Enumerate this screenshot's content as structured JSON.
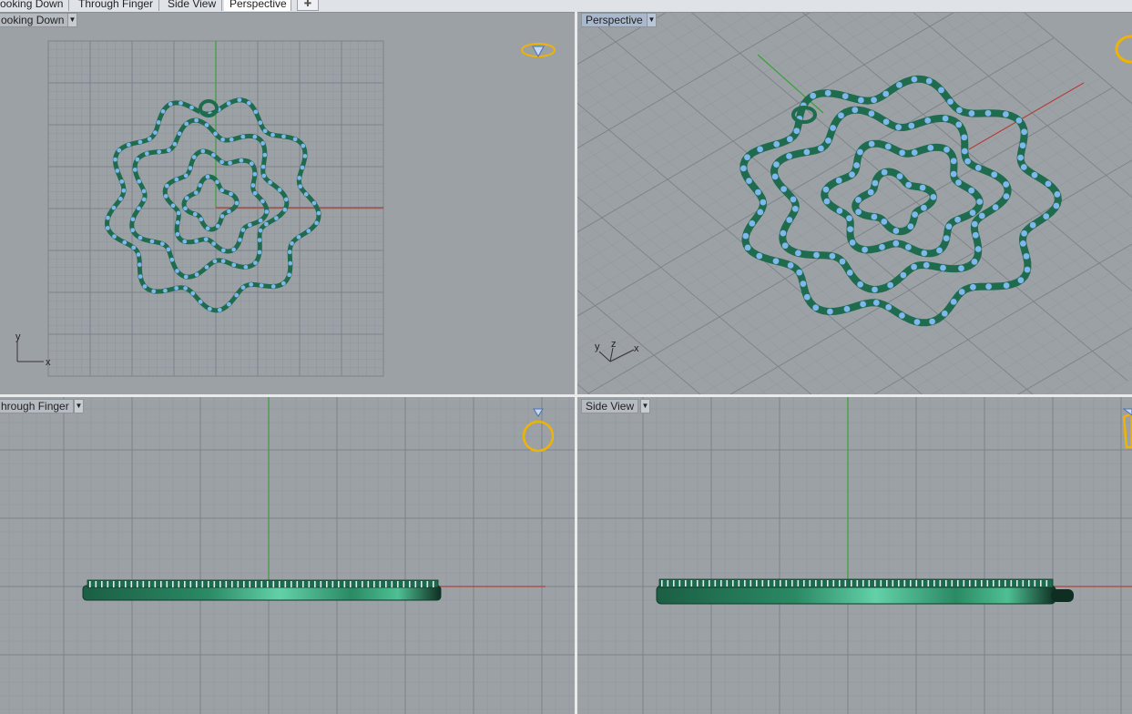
{
  "tabs": [
    {
      "label": "ooking Down",
      "active": false
    },
    {
      "label": "Through Finger",
      "active": false
    },
    {
      "label": "Side View",
      "active": false
    },
    {
      "label": "Perspective",
      "active": true
    }
  ],
  "add_tab_icon": "plus-icon",
  "viewports": {
    "top_left": {
      "label": "ooking Down",
      "axis_x": "x",
      "axis_y": "y",
      "widget_icon": "ring-top-icon"
    },
    "top_right": {
      "label": "Perspective",
      "axis_x": "x",
      "axis_y": "y",
      "axis_z": "z",
      "widget_icon": "ring-perspective-icon"
    },
    "bottom_left": {
      "label": "hrough Finger",
      "widget_icon": "ring-front-icon"
    },
    "bottom_right": {
      "label": "Side View",
      "widget_icon": "ring-side-icon"
    }
  },
  "colors": {
    "background": "#9ca1a6",
    "grid_minor": "#8f959b",
    "grid_major": "#7c8288",
    "axis_x": "#b0423a",
    "axis_y": "#3aa03a",
    "metal": "#1f6b4e",
    "stone": "#7fb8ee",
    "widget": "#f0b400",
    "active_label": "#a9b8cc"
  }
}
